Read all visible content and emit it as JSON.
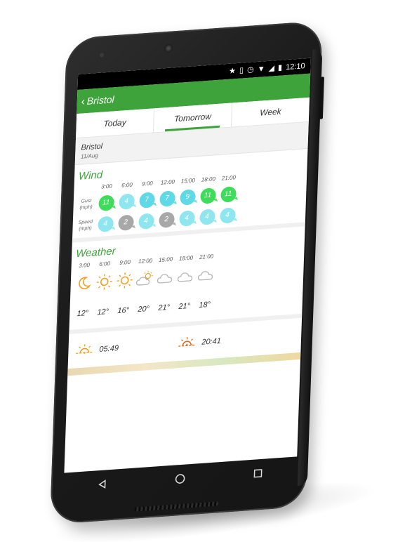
{
  "status_bar": {
    "time": "12:10",
    "icons": [
      "star-icon",
      "vibrate-icon",
      "alarm-icon",
      "wifi-icon",
      "signal-icon",
      "battery-icon"
    ]
  },
  "app_bar": {
    "title": "Bristol",
    "back_icon": "chevron-left-icon",
    "color": "#3fa33b"
  },
  "tabs": [
    {
      "label": "Today",
      "active": false
    },
    {
      "label": "Tomorrow",
      "active": true
    },
    {
      "label": "Week",
      "active": false
    }
  ],
  "location": {
    "name": "Bristol",
    "date": "11/Aug"
  },
  "wind": {
    "title": "Wind",
    "hours": [
      "3:00",
      "6:00",
      "9:00",
      "12:00",
      "15:00",
      "18:00",
      "21:00"
    ],
    "gust_label": "Gust (mph)",
    "speed_label": "Speed (mph)",
    "gust": [
      "11",
      "4",
      "7",
      "7",
      "9",
      "11",
      "11"
    ],
    "gust_colors": [
      "#3ddc5a",
      "#8fe6ef",
      "#5fd9e6",
      "#5fd9e6",
      "#5fd9e6",
      "#3ddc5a",
      "#3ddc5a"
    ],
    "speed": [
      "4",
      "2",
      "4",
      "2",
      "4",
      "4",
      "4"
    ],
    "speed_colors": [
      "#8fe6ef",
      "#a8a8a8",
      "#8fe6ef",
      "#a8a8a8",
      "#8fe6ef",
      "#8fe6ef",
      "#8fe6ef"
    ]
  },
  "weather": {
    "title": "Weather",
    "hours": [
      "3:00",
      "6:00",
      "9:00",
      "12:00",
      "15:00",
      "18:00",
      "21:00"
    ],
    "icons": [
      "moon-icon",
      "sun-icon",
      "sun-icon",
      "partly-cloudy-icon",
      "cloud-icon",
      "cloud-icon",
      "cloud-icon"
    ],
    "temps": [
      "12°",
      "12°",
      "16°",
      "20°",
      "21°",
      "21°",
      "18°"
    ]
  },
  "sun": {
    "sunrise_icon": "sunrise-icon",
    "sunrise": "05:49",
    "sunset_icon": "sunset-icon",
    "sunset": "20:41"
  },
  "nav": {
    "back_icon": "back-triangle-icon",
    "home_icon": "home-circle-icon",
    "recents_icon": "recents-square-icon"
  }
}
